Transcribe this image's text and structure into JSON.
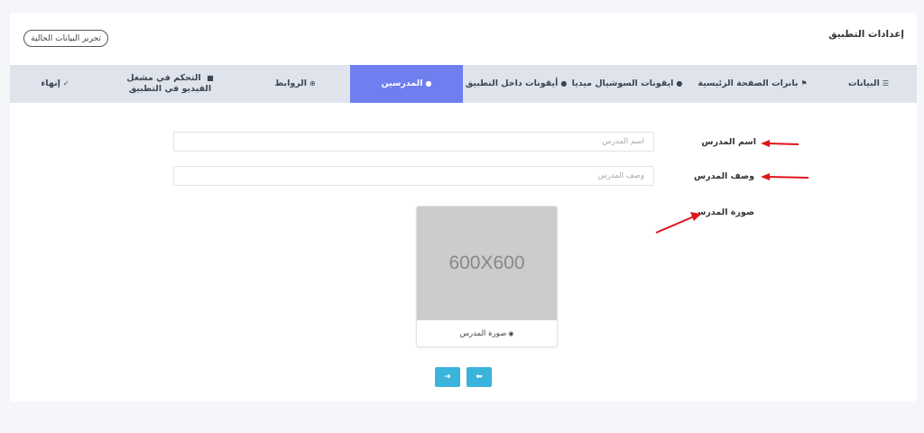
{
  "header": {
    "title": "إعدادات التطبيق",
    "edit_button_label": "تحرير البيانات الحالية"
  },
  "tabs": [
    {
      "icon": "☰",
      "label": "البيانات",
      "active": false
    },
    {
      "icon": "⚑",
      "label": "بانرات الصفحة الرئيسية",
      "active": false
    },
    {
      "icon": "●",
      "label": "ايقونات السوشيال ميديا",
      "active": false
    },
    {
      "icon": "●",
      "label": "أيقونات داخل التطبيق",
      "active": false
    },
    {
      "icon": "●",
      "label": "المدرسين",
      "active": true
    },
    {
      "icon": "⊕",
      "label": "الروابط",
      "active": false
    },
    {
      "icon": "■",
      "label": "التحكم في مشغل الفيديو في التطبيق",
      "active": false
    },
    {
      "icon": "✓",
      "label": "إنهاء",
      "active": false
    }
  ],
  "form": {
    "teacher_name_label": "اسم المدرس",
    "teacher_name_placeholder": "اسم المدرس",
    "teacher_name_value": "",
    "teacher_desc_label": "وصف المدرس",
    "teacher_desc_placeholder": "وصف المدرس",
    "teacher_desc_value": "",
    "teacher_image_label": "صورة المدرس",
    "image_placeholder_text": "600X600",
    "image_caption": "صورة المدرس",
    "image_caption_icon": "camera-icon"
  },
  "navigation": {
    "next_symbol": "➜",
    "prev_symbol": "⬅"
  },
  "colors": {
    "active_tab": "#6f7ff0",
    "tab_bar": "#dfe4ec",
    "nav_button": "#3ab4dc",
    "annotation_arrow": "#e0141c"
  }
}
